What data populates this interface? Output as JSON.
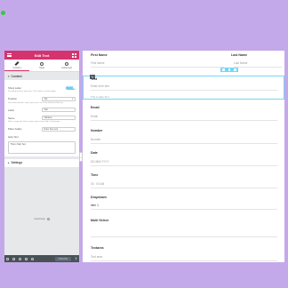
{
  "panel": {
    "title": "Edit Text",
    "tabs": [
      {
        "label": "Content",
        "icon": "pencil-icon"
      },
      {
        "label": "Style",
        "icon": "circle-half-icon"
      },
      {
        "label": "Advanced",
        "icon": "gear-icon"
      }
    ],
    "content_section": "Content",
    "show_label": {
      "label": "Show Label",
      "toggle": "SHOW",
      "hint": "No editing mode on input form. Click inside to not edit widget."
    },
    "position": {
      "label": "Position",
      "value": "Top",
      "hint": "Select label position, where you want to set it? By default it will be top."
    },
    "label": {
      "label": "Label",
      "value": "Text"
    },
    "name": {
      "label": "Name",
      "value": "fullname",
      "hint": "Name is important. Enter unique name of your field in all manager."
    },
    "placeholder": {
      "label": "Place holder",
      "value": "Enter here text"
    },
    "help_text": {
      "label": "Help Text",
      "value": "This is Help Text"
    },
    "settings_section": "Settings",
    "need_help": "Need Help",
    "update_label": "UPDATE",
    "footer_icons": [
      "settings-icon",
      "layers-icon",
      "history-icon",
      "responsive-icon",
      "eye-icon"
    ]
  },
  "form": {
    "first_name": {
      "label": "First Name",
      "placeholder": "First Name"
    },
    "last_name": {
      "label": "Last Name",
      "placeholder": "Last Name"
    },
    "text": {
      "label": "Text",
      "placeholder": "Enter here text",
      "help": "This is Help Text"
    },
    "email": {
      "label": "Email",
      "placeholder": "Email"
    },
    "number": {
      "label": "Number",
      "placeholder": "Number"
    },
    "date": {
      "label": "Date",
      "placeholder": "DD-MM-YYYY"
    },
    "time": {
      "label": "Time",
      "placeholder": "00 : 00 AM"
    },
    "dropdown": {
      "label": "Dropdown",
      "value": "Item 1"
    },
    "multi_select": {
      "label": "Multi Select"
    },
    "textarea": {
      "label": "Textarea",
      "placeholder": "Text area"
    }
  },
  "colors": {
    "accent": "#d5336d",
    "selection": "#71d7f7",
    "background": "#c4a9ea",
    "toggle": "#77c9ef"
  }
}
